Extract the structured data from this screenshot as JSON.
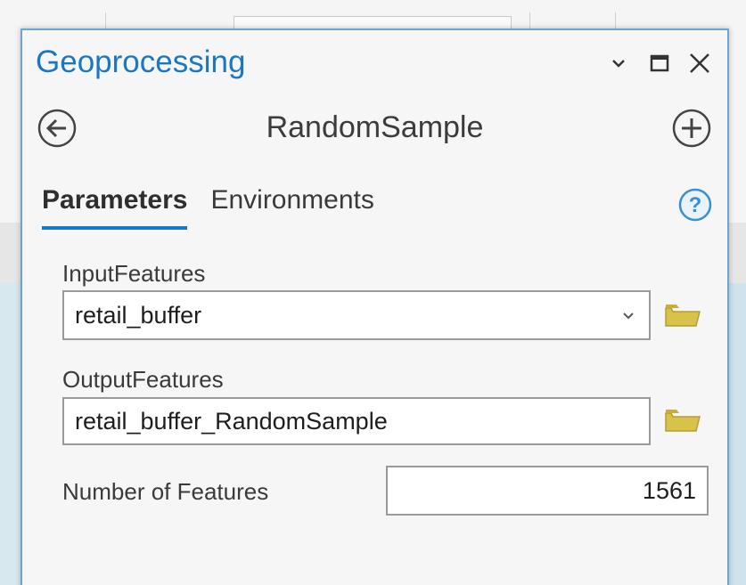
{
  "pane": {
    "title": "Geoprocessing",
    "tool_name": "RandomSample"
  },
  "tabs": [
    {
      "label": "Parameters",
      "active": true
    },
    {
      "label": "Environments",
      "active": false
    }
  ],
  "params": {
    "input_features": {
      "label": "InputFeatures",
      "value": "retail_buffer"
    },
    "output_features": {
      "label": "OutputFeatures",
      "value": "retail_buffer_RandomSample"
    },
    "number_of_features": {
      "label": "Number of Features",
      "value": "1561"
    }
  },
  "colors": {
    "accent": "#1a78c2",
    "folder": "#d9c24a",
    "help": "#3a8fd4"
  },
  "icons": [
    "chevron-down-icon",
    "maximize-icon",
    "close-icon",
    "back-arrow-icon",
    "add-icon",
    "help-icon",
    "dropdown-icon",
    "folder-icon"
  ]
}
